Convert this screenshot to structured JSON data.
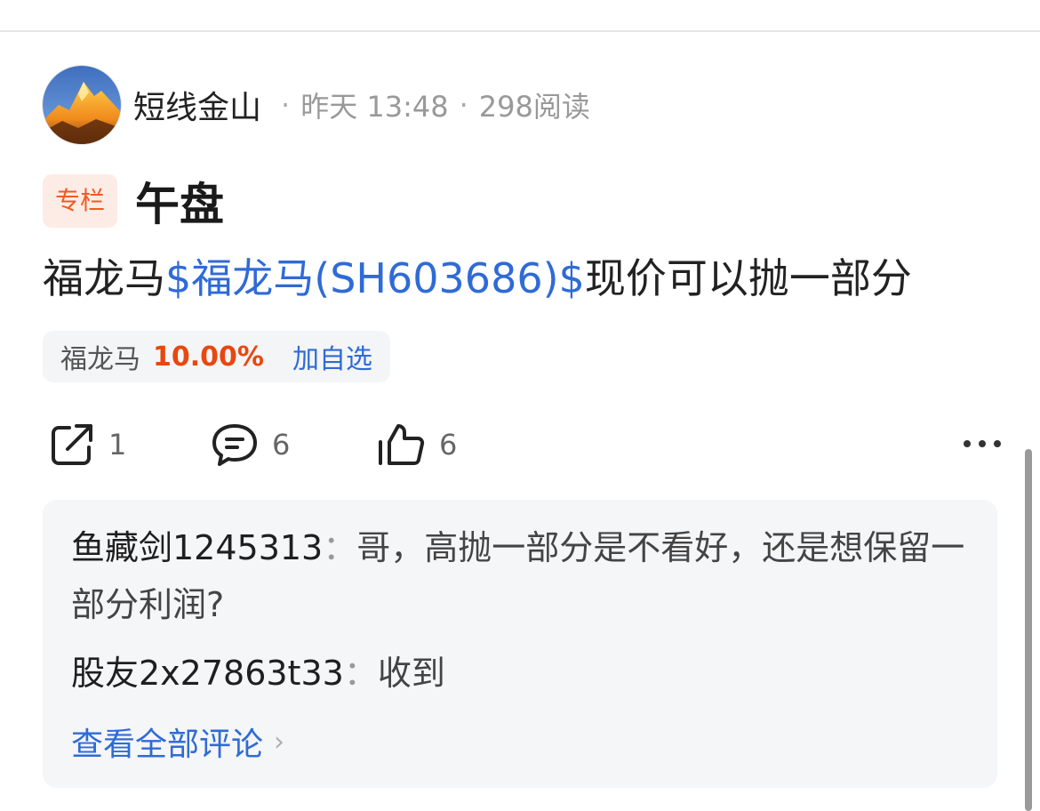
{
  "author": {
    "name": "短线金山",
    "time": "昨天 13:48",
    "views": "298阅读",
    "separator": "·"
  },
  "post": {
    "badge": "专栏",
    "title": "午盘",
    "body_prefix": "福龙马",
    "stock_link": "$福龙马(SH603686)$",
    "body_suffix": "现价可以抛一部分"
  },
  "stock_chip": {
    "name": "福龙马",
    "change": "10.00%",
    "add_label": "加自选"
  },
  "actions": {
    "share": {
      "icon": "share-icon",
      "count": "1"
    },
    "comment": {
      "icon": "comment-icon",
      "count": "6"
    },
    "like": {
      "icon": "thumbs-up-icon",
      "count": "6"
    },
    "more": {
      "icon": "more-icon"
    }
  },
  "comments": [
    {
      "user": "鱼藏剑1245313",
      "sep": "：",
      "text": "哥，高抛一部分是不看好，还是想保留一部分利润?"
    },
    {
      "user": "股友2x27863t33",
      "sep": "：",
      "text": "收到"
    }
  ],
  "view_all": {
    "label": "查看全部评论",
    "chevron": "›"
  },
  "colors": {
    "link": "#2f6bd6",
    "up": "#e8470f",
    "badge_text": "#f05a24",
    "badge_bg": "#fdece5"
  }
}
